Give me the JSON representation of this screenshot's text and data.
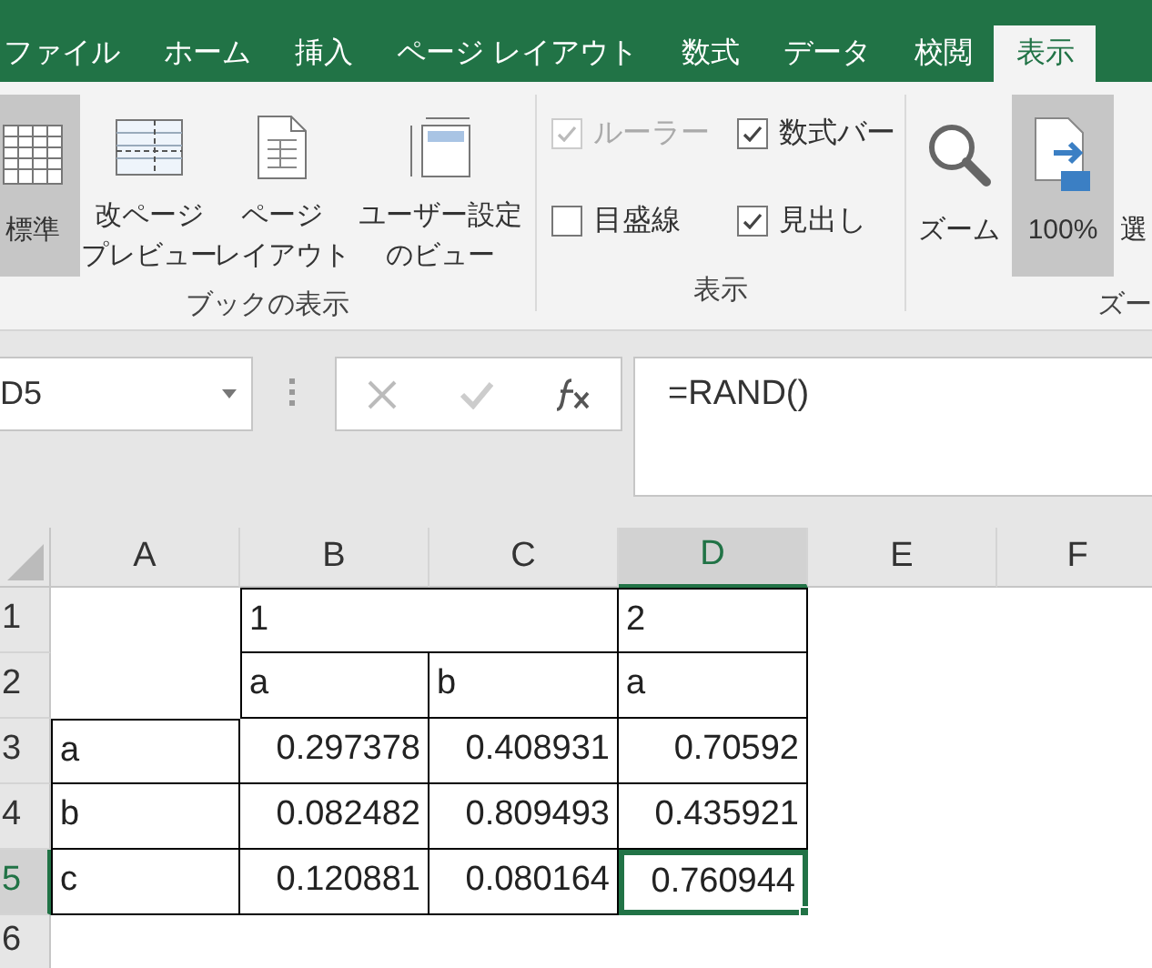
{
  "tabs": [
    {
      "label": "ファイル",
      "selected": false
    },
    {
      "label": "ホーム",
      "selected": false
    },
    {
      "label": "挿入",
      "selected": false
    },
    {
      "label": "ページ レイアウト",
      "selected": false
    },
    {
      "label": "数式",
      "selected": false
    },
    {
      "label": "データ",
      "selected": false
    },
    {
      "label": "校閲",
      "selected": false
    },
    {
      "label": "表示",
      "selected": true
    }
  ],
  "ribbon": {
    "book_view": {
      "label": "ブックの表示",
      "buttons": [
        {
          "lines": [
            "標準"
          ],
          "selected": true
        },
        {
          "lines": [
            "改ページ",
            "プレビュー"
          ],
          "selected": false
        },
        {
          "lines": [
            "ページ",
            "レイアウト"
          ],
          "selected": false
        },
        {
          "lines": [
            "ユーザー設定",
            "のビュー"
          ],
          "selected": false
        }
      ]
    },
    "show": {
      "label": "表示",
      "options": [
        {
          "label": "ルーラー",
          "checked": true,
          "disabled": true
        },
        {
          "label": "数式バー",
          "checked": true,
          "disabled": false
        },
        {
          "label": "目盛線",
          "checked": false,
          "disabled": false
        },
        {
          "label": "見出し",
          "checked": true,
          "disabled": false
        }
      ]
    },
    "zoom": {
      "label": "ズー",
      "buttons": [
        {
          "lines": [
            "ズーム"
          ],
          "selected": false
        },
        {
          "lines": [
            "100%"
          ],
          "selected": true
        },
        {
          "lines": [
            "選"
          ],
          "selected": false
        }
      ]
    }
  },
  "name_box": {
    "value": "D5"
  },
  "formula_bar": {
    "value": "=RAND()"
  },
  "sheet": {
    "columns": [
      {
        "label": "A",
        "selected": false
      },
      {
        "label": "B",
        "selected": false
      },
      {
        "label": "C",
        "selected": false
      },
      {
        "label": "D",
        "selected": true
      },
      {
        "label": "E",
        "selected": false
      },
      {
        "label": "F",
        "selected": false
      }
    ],
    "rows": [
      {
        "label": "1",
        "selected": false
      },
      {
        "label": "2",
        "selected": false
      },
      {
        "label": "3",
        "selected": false
      },
      {
        "label": "4",
        "selected": false
      },
      {
        "label": "5",
        "selected": true
      },
      {
        "label": "6",
        "selected": false
      }
    ],
    "cells": [
      [
        {
          "kind": "empty"
        },
        {
          "kind": "text",
          "text": "1",
          "selected": false
        },
        {
          "kind": "merged"
        },
        {
          "kind": "text",
          "text": "2",
          "selected": false
        }
      ],
      [
        {
          "kind": "empty"
        },
        {
          "kind": "text",
          "text": "a",
          "selected": false
        },
        {
          "kind": "text",
          "text": "b",
          "selected": false
        },
        {
          "kind": "text",
          "text": "a",
          "selected": false
        }
      ],
      [
        {
          "kind": "text",
          "text": "a",
          "selected": false
        },
        {
          "kind": "number",
          "text": "0.297378",
          "selected": false
        },
        {
          "kind": "number",
          "text": "0.408931",
          "selected": false
        },
        {
          "kind": "number",
          "text": "0.70592",
          "selected": false
        }
      ],
      [
        {
          "kind": "text",
          "text": "b",
          "selected": false
        },
        {
          "kind": "number",
          "text": "0.082482",
          "selected": false
        },
        {
          "kind": "number",
          "text": "0.809493",
          "selected": false
        },
        {
          "kind": "number",
          "text": "0.435921",
          "selected": false
        }
      ],
      [
        {
          "kind": "text",
          "text": "c",
          "selected": false
        },
        {
          "kind": "number",
          "text": "0.120881",
          "selected": false
        },
        {
          "kind": "number",
          "text": "0.080164",
          "selected": false
        },
        {
          "kind": "number",
          "text": "0.760944",
          "selected": true
        }
      ]
    ]
  }
}
